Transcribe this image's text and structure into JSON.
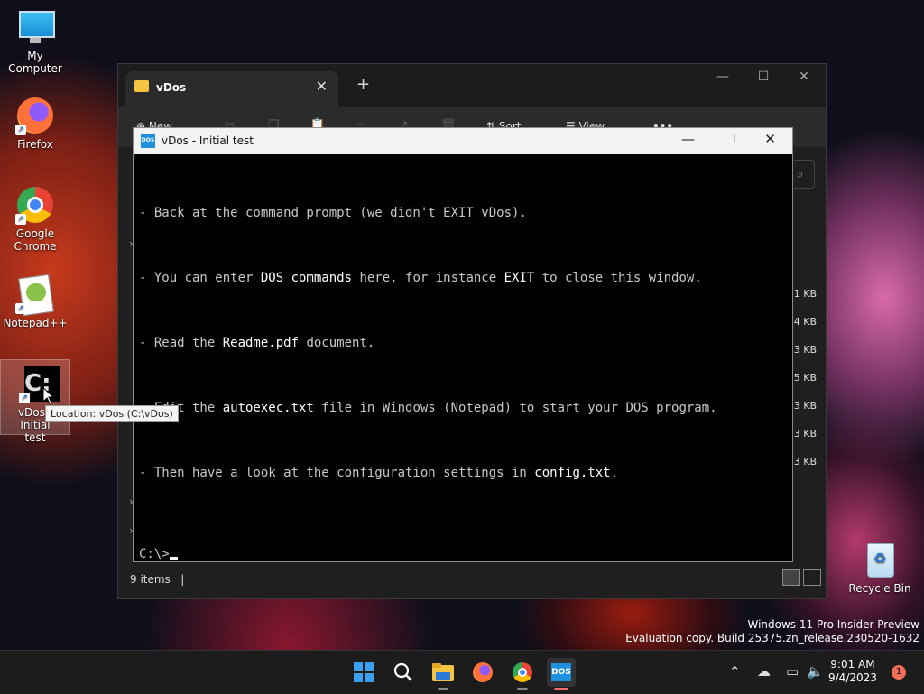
{
  "desktop": {
    "icons": [
      {
        "label": "My Computer",
        "icon": "monitor-icon"
      },
      {
        "label": "Firefox",
        "icon": "firefox-icon"
      },
      {
        "label": "Google Chrome",
        "icon": "chrome-icon"
      },
      {
        "label": "Notepad++",
        "icon": "notepadpp-icon"
      },
      {
        "label": "vDos - Initial test",
        "icon": "vdos-shortcut-icon"
      },
      {
        "label": "Recycle Bin",
        "icon": "recycle-bin-icon"
      }
    ],
    "tooltip": "Location: vDos (C:\\vDos)"
  },
  "explorer": {
    "tab_title": "vDos",
    "toolbar": {
      "new_label": "New",
      "sort_label": "Sort",
      "view_label": "View",
      "more_label": "•••"
    },
    "sizes": [
      "1 KB",
      "4 KB",
      "3 KB",
      "5 KB",
      "3 KB",
      "3 KB",
      "3 KB"
    ],
    "status_items": "9 items"
  },
  "vdos": {
    "title": "vDos - Initial test",
    "logo_text": "DOS",
    "lines": [
      [
        "- Back at the command prompt (we didn't EXIT vDos).",
        "",
        "",
        "",
        ""
      ],
      [
        "- You can enter ",
        "DOS commands",
        " here, for instance ",
        "EXIT",
        " to close this window."
      ],
      [
        "- Read the ",
        "Readme.pdf",
        " document.",
        "",
        ""
      ],
      [
        "- Edit the ",
        "autoexec.txt",
        " file in Windows (Notepad) to start your DOS program.",
        "",
        ""
      ],
      [
        "- Then have a look at the configuration settings in ",
        "config.txt",
        ".",
        "",
        ""
      ]
    ],
    "prompt": "C:\\>"
  },
  "watermark": {
    "line1": "Windows 11 Pro Insider Preview",
    "line2": "Evaluation copy. Build 25375.zn_release.230520-1632"
  },
  "taskbar": {
    "time": "9:01 AM",
    "date": "9/4/2023",
    "notification_count": "1",
    "colors": {
      "accent": "#1f8fe0",
      "notification": "#f06d5a"
    }
  }
}
